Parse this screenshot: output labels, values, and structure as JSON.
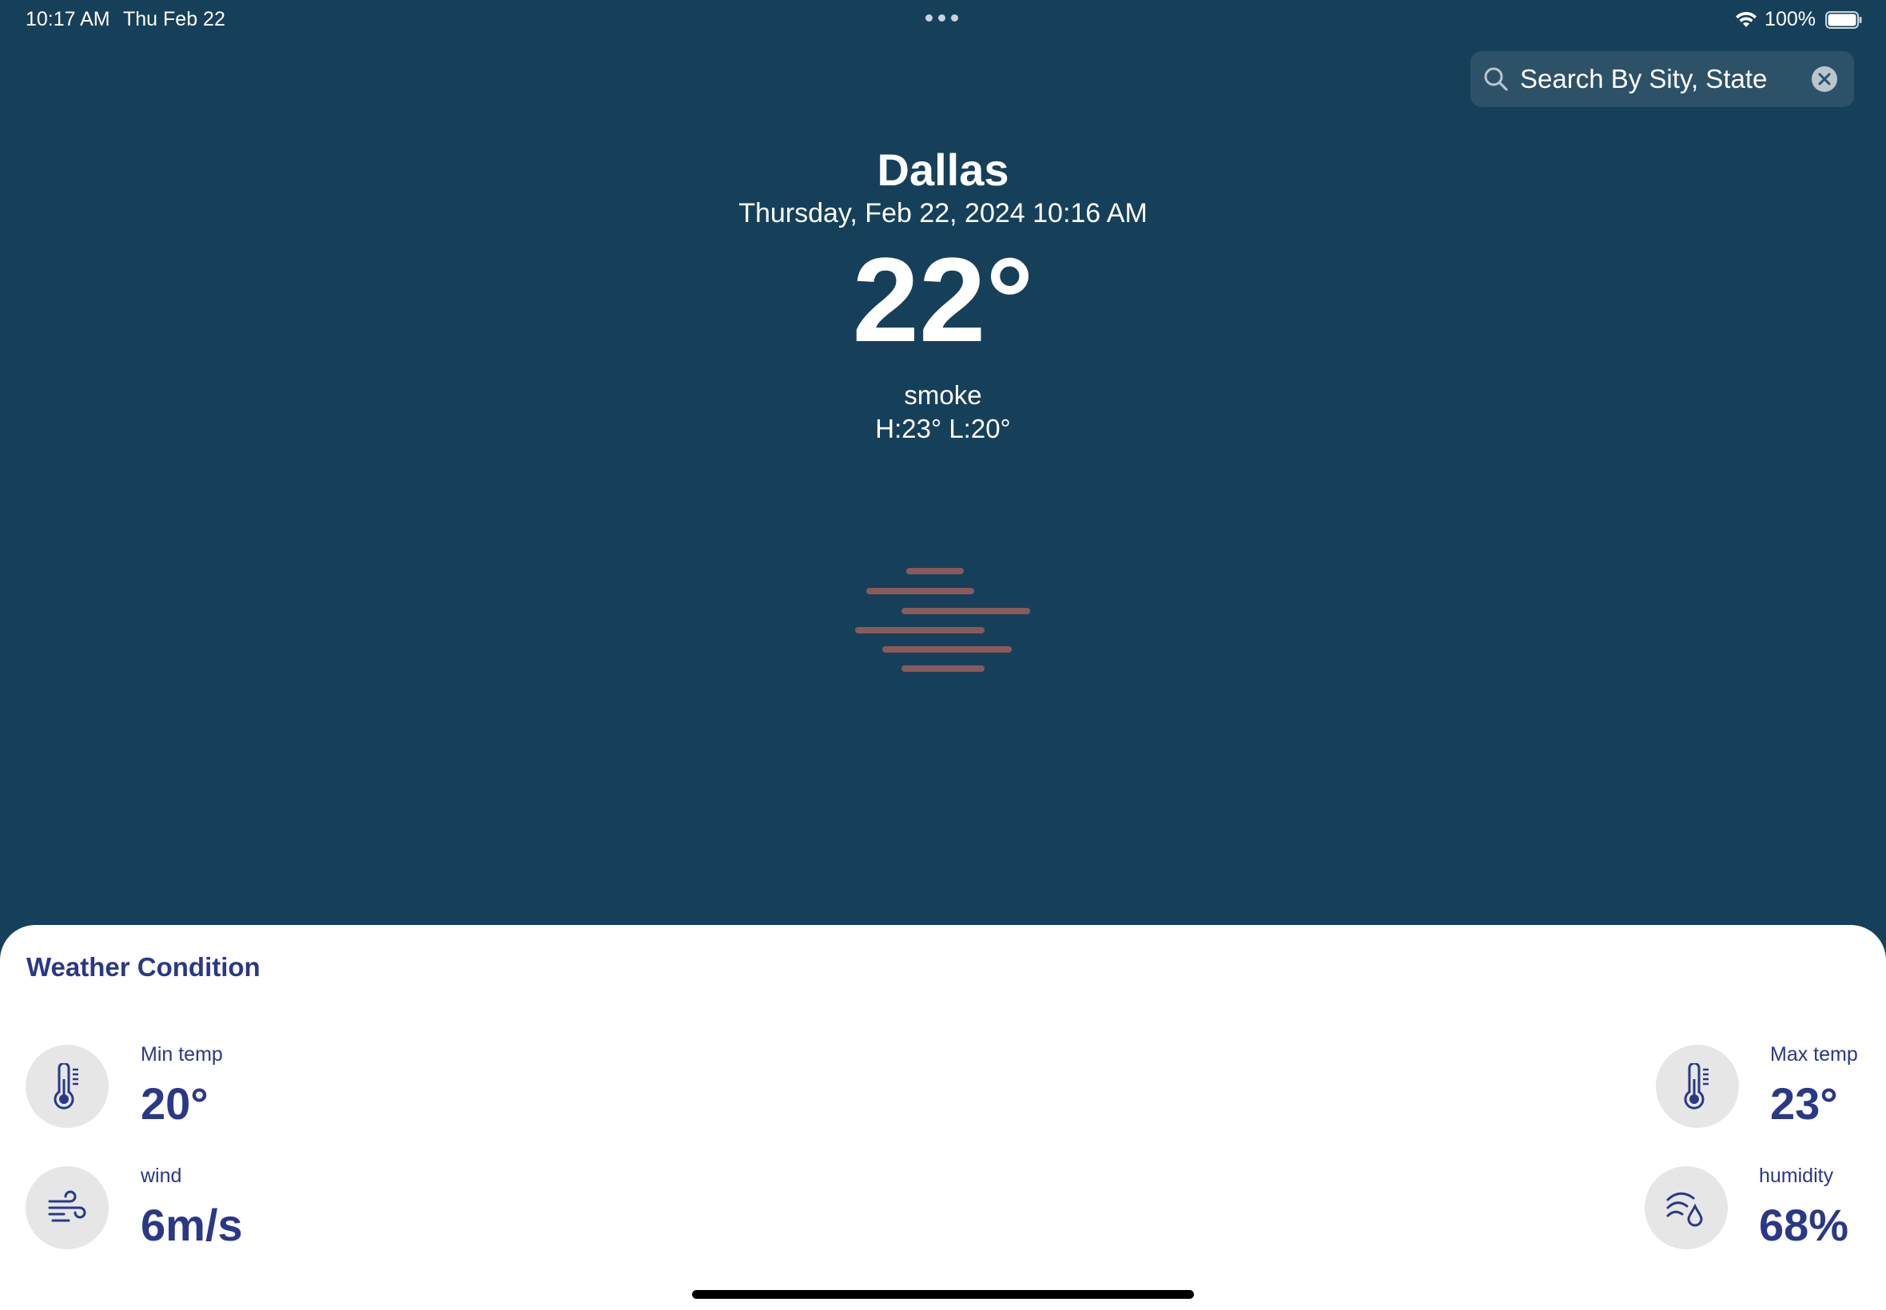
{
  "status_bar": {
    "time": "10:17 AM",
    "date": "Thu Feb 22",
    "battery": "100%"
  },
  "search": {
    "placeholder": "Search By Sity, State"
  },
  "weather": {
    "city": "Dallas",
    "datetime": "Thursday, Feb 22, 2024 10:16 AM",
    "temperature": "22°",
    "condition": "smoke",
    "high_low": "H:23°  L:20°",
    "condition_icon": "smoke-icon"
  },
  "condition_card": {
    "title": "Weather Condition",
    "metrics": {
      "min_temp": {
        "label": "Min temp",
        "value": "20°",
        "icon": "thermometer-icon"
      },
      "max_temp": {
        "label": "Max temp",
        "value": "23°",
        "icon": "thermometer-icon"
      },
      "wind": {
        "label": "wind",
        "value": "6m/s",
        "icon": "wind-icon"
      },
      "humidity": {
        "label": "humidity",
        "value": "68%",
        "icon": "humidity-icon"
      }
    }
  },
  "colors": {
    "background": "#16405a",
    "accent": "#2a3888",
    "smoke": "#8a5a5a"
  }
}
